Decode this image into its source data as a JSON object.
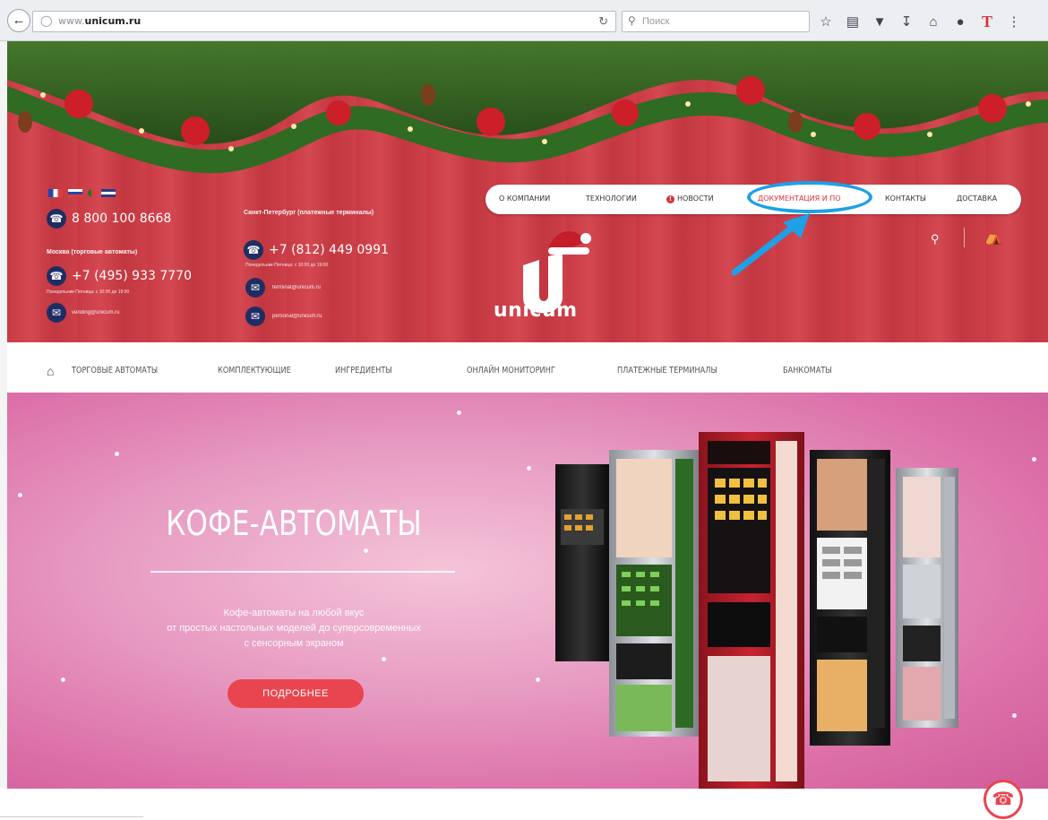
{
  "browser": {
    "url_prefix": "www.",
    "url_host": "unicum.ru",
    "search_placeholder": "Поиск",
    "toolbar_icons": [
      "star-icon",
      "clipboard-icon",
      "pocket-icon",
      "download-icon",
      "home-icon",
      "chat-icon",
      "t-icon",
      "menu-icon"
    ],
    "t_label": "T"
  },
  "header": {
    "phone_main": "8 800 100 8668",
    "moscow_label": "Москва (торговые автоматы)",
    "moscow_phone": "+7 (495) 933 7770",
    "moscow_hours": "Понедельник-Пятница: с 10:00 до 19:00",
    "moscow_email": "vending@unicum.ru",
    "spb_label": "Санкт-Петербург (платежные терминалы)",
    "spb_phone": "+7 (812) 449 0991",
    "spb_hours": "Понедельник-Пятница: с 10:00 до 19:00",
    "spb_email_1": "terminal@unicum.ru",
    "spb_email_2": "personal@unicum.ru",
    "logo_text": "unicum"
  },
  "nav": {
    "items": [
      "О КОМПАНИИ",
      "ТЕХНОЛОГИИ",
      "НОВОСТИ",
      "ДОКУМЕНТАЦИЯ И ПО",
      "КОНТАКТЫ",
      "ДОСТАВКА"
    ],
    "news_badge": "!",
    "active_index": 3
  },
  "categories": [
    "ТОРГОВЫЕ АВТОМАТЫ",
    "КОМПЛЕКТУЮЩИЕ",
    "ИНГРЕДИЕНТЫ",
    "ОНЛАЙН МОНИТОРИНГ",
    "ПЛАТЕЖНЫЕ ТЕРМИНАЛЫ",
    "БАНКОМАТЫ"
  ],
  "hero": {
    "title": "КОФЕ-АВТОМАТЫ",
    "desc_line1": "Кофе-автоматы на любой вкус",
    "desc_line2": "от простых настольных моделей до суперсовременных",
    "desc_line3": "с сенсорным экраном",
    "button": "ПОДРОБНЕЕ"
  },
  "colors": {
    "brand_red": "#d8323a",
    "annotation_blue": "#1ea0e6",
    "hero_button": "#e8454f"
  }
}
